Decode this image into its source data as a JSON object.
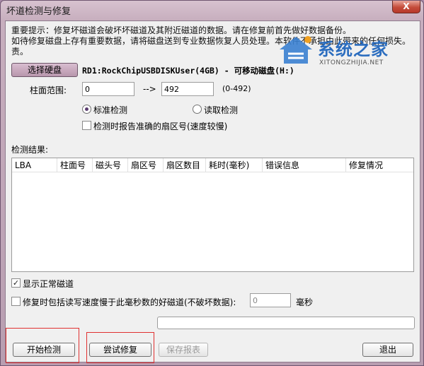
{
  "window": {
    "title": "坏道检测与修复",
    "close_label": "X"
  },
  "notice": {
    "line1": "重要提示：修复坏磁道会破坏坏磁道及其附近磁道的数据。请在修复前首先做好数据备份。",
    "line2": "如待修复磁盘上存有重要数据，请将磁盘送到专业数据恢复人员处理。本软件不承担由此带来的任何损失。",
    "line3": "责。"
  },
  "watermark": {
    "text": "系统之家",
    "sub": "XITONGZHIJIA.NET"
  },
  "disk": {
    "select_button": "选择硬盘",
    "label": "RD1:RockChipUSBDISKUser(4GB) - 可移动磁盘(H:)"
  },
  "cylinder": {
    "label": "柱面范围:",
    "from": "0",
    "arrow": "-->",
    "to": "492",
    "range": "(0-492)"
  },
  "options": {
    "standard": "标准检测",
    "standard_selected": true,
    "read": "读取检测",
    "read_selected": false,
    "report_sector": "检测时报告准确的扇区号(速度较慢)",
    "report_sector_checked": false
  },
  "results": {
    "label": "检测结果:",
    "columns": [
      "LBA",
      "柱面号",
      "磁头号",
      "扇区号",
      "扇区数目",
      "耗时(毫秒)",
      "错误信息",
      "修复情况"
    ]
  },
  "show_normal": {
    "label": "显示正常磁道",
    "checked": true
  },
  "repair_slow": {
    "label": "修复时包括读写速度慢于此毫秒数的好磁道(不破坏数据):",
    "checked": false,
    "value": "0",
    "unit": "毫秒"
  },
  "buttons": {
    "start": "开始检测",
    "try_repair": "尝试修复",
    "save_report": "保存报表",
    "exit": "退出"
  }
}
